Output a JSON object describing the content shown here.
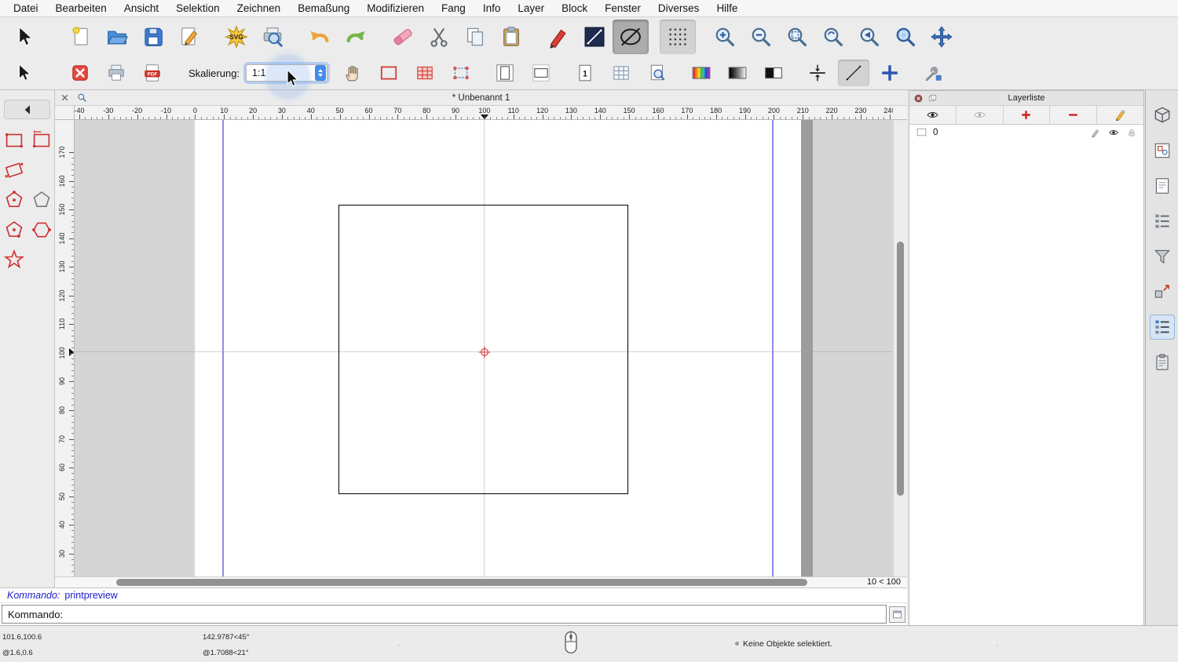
{
  "menubar": {
    "items": [
      "Datei",
      "Bearbeiten",
      "Ansicht",
      "Selektion",
      "Zeichnen",
      "Bemaßung",
      "Modifizieren",
      "Fang",
      "Info",
      "Layer",
      "Block",
      "Fenster",
      "Diverses",
      "Hilfe"
    ]
  },
  "icon_labels": {
    "svg": "SVG",
    "pdf": "PDF",
    "page_one": "1"
  },
  "toolbar_main": {
    "groups": [
      [
        {
          "name": "selection-tool",
          "icon": "select-arrow"
        }
      ],
      [
        {
          "name": "new-drawing",
          "icon": "new-file"
        },
        {
          "name": "open-drawing",
          "icon": "open-folder"
        },
        {
          "name": "save-drawing",
          "icon": "save-file"
        },
        {
          "name": "drawing-preferences",
          "icon": "edit-drawing"
        }
      ],
      [
        {
          "name": "svg-export",
          "icon": "svg-star"
        },
        {
          "name": "print-preview",
          "icon": "print-preview"
        }
      ],
      [
        {
          "name": "undo",
          "icon": "undo"
        },
        {
          "name": "redo",
          "icon": "redo"
        }
      ],
      [
        {
          "name": "delete",
          "icon": "eraser"
        },
        {
          "name": "cut",
          "icon": "scissors"
        },
        {
          "name": "copy",
          "icon": "copy"
        },
        {
          "name": "paste",
          "icon": "paste"
        }
      ],
      [
        {
          "name": "draw-tools",
          "icon": "red-pen"
        },
        {
          "name": "line-tools",
          "icon": "line-box"
        },
        {
          "name": "ellipse-tools",
          "icon": "ellipse-slash",
          "state": "pressed"
        }
      ],
      [
        {
          "name": "grid-toggle",
          "icon": "grid-dots",
          "state": "pressed-light"
        }
      ],
      [
        {
          "name": "zoom-in",
          "icon": "zoom-in"
        },
        {
          "name": "zoom-out",
          "icon": "zoom-out"
        },
        {
          "name": "auto-zoom",
          "icon": "zoom-auto"
        },
        {
          "name": "zoom-redraw",
          "icon": "zoom-redraw"
        },
        {
          "name": "previous-view",
          "icon": "zoom-previous"
        },
        {
          "name": "zoom-window",
          "icon": "zoom-window"
        },
        {
          "name": "pan-zoom",
          "icon": "pan-arrows"
        }
      ]
    ]
  },
  "print_toolbar": {
    "scale_label": "Skalierung:",
    "scale_value": "1:1",
    "left_groups": [
      [
        {
          "name": "selection-tool-preview",
          "icon": "select-arrow"
        }
      ],
      [
        {
          "name": "close-print-preview",
          "icon": "close-red"
        },
        {
          "name": "print",
          "icon": "printer"
        },
        {
          "name": "pdf-export",
          "icon": "pdf"
        }
      ]
    ],
    "right_groups": [
      [
        {
          "name": "pan-hand",
          "icon": "hand"
        },
        {
          "name": "paper-borders",
          "icon": "red-rect"
        },
        {
          "name": "paper-tiling",
          "icon": "red-grid"
        },
        {
          "name": "crop-marks",
          "icon": "selection-handles"
        }
      ],
      [
        {
          "name": "page-portrait",
          "icon": "page-portrait"
        },
        {
          "name": "page-landscape",
          "icon": "page-landscape"
        }
      ],
      [
        {
          "name": "single-page",
          "icon": "page-one"
        },
        {
          "name": "page-grid",
          "icon": "table-grid"
        },
        {
          "name": "zoom-to-page",
          "icon": "zoom-page"
        }
      ],
      [
        {
          "name": "full-color-mode",
          "icon": "color-rainbow"
        },
        {
          "name": "grayscale-mode",
          "icon": "color-gray"
        },
        {
          "name": "black-white-mode",
          "icon": "color-bw"
        }
      ],
      [
        {
          "name": "fit-to-height",
          "icon": "fit-vertical"
        },
        {
          "name": "draft-mode",
          "icon": "draft-line",
          "state": "pressed-light"
        },
        {
          "name": "center-crosshair",
          "icon": "blue-plus"
        }
      ],
      [
        {
          "name": "preferences",
          "icon": "wrench"
        }
      ]
    ]
  },
  "palette": {
    "tools": [
      {
        "name": "rectangle-2points",
        "icon": "rect-2p"
      },
      {
        "name": "rectangle-size",
        "icon": "rect-size"
      },
      {
        "name": "rectangle-angle",
        "icon": "rect-angle"
      },
      null,
      {
        "name": "polygon-center-vertex",
        "icon": "polygon-center"
      },
      {
        "name": "polygon-gray",
        "icon": "polygon-gray"
      },
      {
        "name": "polygon-2vertex",
        "icon": "polygon-2p"
      },
      {
        "name": "polygon-side",
        "icon": "hexagon-dots"
      },
      {
        "name": "star-shape",
        "icon": "star"
      },
      null
    ]
  },
  "document": {
    "title": "* Unbenannt 1",
    "scroll_indicator": "10 < 100",
    "rulers": {
      "h": [
        "-40",
        "-30",
        "-20",
        "-10",
        "0",
        "10",
        "20",
        "30",
        "40",
        "50",
        "60",
        "70",
        "80",
        "90",
        "100",
        "110",
        "120",
        "130",
        "140",
        "150",
        "160",
        "170",
        "180",
        "190",
        "200",
        "210",
        "220",
        "230",
        "240"
      ],
      "v": [
        "170",
        "160",
        "150",
        "140",
        "130",
        "120",
        "110",
        "100",
        "90",
        "80",
        "70",
        "60",
        "50",
        "40",
        "30"
      ]
    }
  },
  "command_line": {
    "history_prompt": "Kommando:",
    "history_entry": "printpreview",
    "prompt_label": "Kommando:",
    "input_value": ""
  },
  "status_bar": {
    "abs_cartesian": "101.6,100.6",
    "rel_cartesian": "@1.6,0.6",
    "abs_polar": "142.9787<45°",
    "rel_polar": "@1.7088<21°",
    "selection_info": "Keine Objekte selektiert."
  },
  "layer_panel": {
    "title": "Layerliste",
    "toolbar": [
      {
        "name": "show-all-layers",
        "icon": "eye"
      },
      {
        "name": "hide-all-layers",
        "icon": "eye-light"
      },
      {
        "name": "add-layer",
        "icon": "plus-red"
      },
      {
        "name": "remove-layer",
        "icon": "minus-red"
      },
      {
        "name": "edit-layer",
        "icon": "pencil"
      }
    ],
    "layers": [
      {
        "name": "0"
      }
    ]
  },
  "right_dock": {
    "buttons": [
      {
        "name": "property-editor-panel",
        "icon": "panel-cube"
      },
      {
        "name": "view-list-panel",
        "icon": "panel-views"
      },
      {
        "name": "sheet-panel",
        "icon": "panel-sheet"
      },
      {
        "name": "command-history-panel",
        "icon": "panel-list"
      },
      {
        "name": "selection-filter-panel",
        "icon": "panel-filter"
      },
      {
        "name": "block-list-panel",
        "icon": "panel-block"
      },
      {
        "name": "layer-list-panel",
        "icon": "panel-layers",
        "state": "selected"
      },
      {
        "name": "library-browser-panel",
        "icon": "panel-clipboard"
      }
    ]
  },
  "colors": {
    "accent_blue": "#3f8ced",
    "guide_blue": "#8c8cec",
    "tool_red": "#cf3030",
    "command_blue": "#1a1acc",
    "selected_dock": "#d6e4f5"
  }
}
